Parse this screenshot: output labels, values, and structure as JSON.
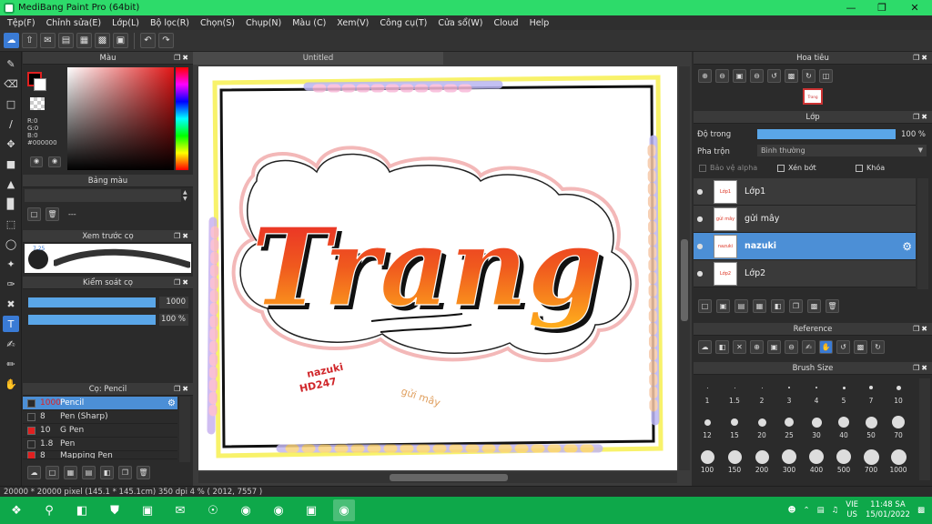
{
  "window": {
    "title": "MediBang Paint Pro (64bit)"
  },
  "menu": [
    "Tệp(F)",
    "Chỉnh sửa(E)",
    "Lớp(L)",
    "Bộ lọc(R)",
    "Chọn(S)",
    "Chụp(N)",
    "Màu (C)",
    "Xem(V)",
    "Công cụ(T)",
    "Cửa sổ(W)",
    "Cloud",
    "Help"
  ],
  "color_panel": {
    "title": "Màu",
    "r": "R:0",
    "g": "G:0",
    "b": "B:0",
    "hex": "#000000",
    "fg": "#000000",
    "bg": "#ffffff",
    "accent": "#e02020"
  },
  "palette_panel": {
    "title": "Bảng màu",
    "dashes": "---"
  },
  "brush_preview": {
    "title": "Xem trước cọ",
    "size": "7.25"
  },
  "brush_control": {
    "title": "Kiểm soát cọ",
    "size_value": "1000",
    "opacity_value": "100 %"
  },
  "brush_list": {
    "title": "Cọ: Pencil",
    "items": [
      {
        "size": "1000",
        "name": "Pencil",
        "color": "#2a2a2a",
        "selected": true
      },
      {
        "size": "8",
        "name": "Pen (Sharp)",
        "color": "#2a2a2a",
        "selected": false
      },
      {
        "size": "10",
        "name": "G Pen",
        "color": "#e02020",
        "selected": false
      },
      {
        "size": "1.8",
        "name": "Pen",
        "color": "#2a2a2a",
        "selected": false
      },
      {
        "size": "8",
        "name": "Mapping Pen",
        "color": "#e02020",
        "selected": false
      }
    ]
  },
  "canvas": {
    "tab": "Untitled",
    "text_main": "Trang",
    "text_nazuki": "nazuki",
    "text_hd": "HD247",
    "text_gui": "gửi mây"
  },
  "navigator": {
    "title": "Hoa tiêu"
  },
  "layers_panel": {
    "title": "Lớp",
    "opacity_label": "Độ trong",
    "opacity_value": "100 %",
    "blend_label": "Pha trộn",
    "blend_value": "Bình thường",
    "protect_alpha": "Bảo vệ alpha",
    "clipping": "Xén bớt",
    "lock": "Khóa",
    "layers": [
      {
        "name": "Lớp1",
        "selected": false
      },
      {
        "name": "gửi mây",
        "selected": false
      },
      {
        "name": "nazuki",
        "selected": true
      },
      {
        "name": "Lớp2",
        "selected": false
      }
    ]
  },
  "reference": {
    "title": "Reference"
  },
  "brush_size": {
    "title": "Brush Size",
    "sizes": [
      "1",
      "1.5",
      "2",
      "3",
      "4",
      "5",
      "7",
      "10",
      "12",
      "15",
      "20",
      "25",
      "30",
      "40",
      "50",
      "70",
      "100",
      "150",
      "200",
      "300",
      "400",
      "500",
      "700",
      "1000"
    ]
  },
  "status": {
    "text": "20000 * 20000 pixel  (145.1 * 145.1cm)  350 dpi  4 %  ( 2012, 7557 )"
  },
  "taskbar": {
    "lang1": "VIE",
    "lang2": "US",
    "time": "11:48 SA",
    "date": "15/01/2022"
  }
}
